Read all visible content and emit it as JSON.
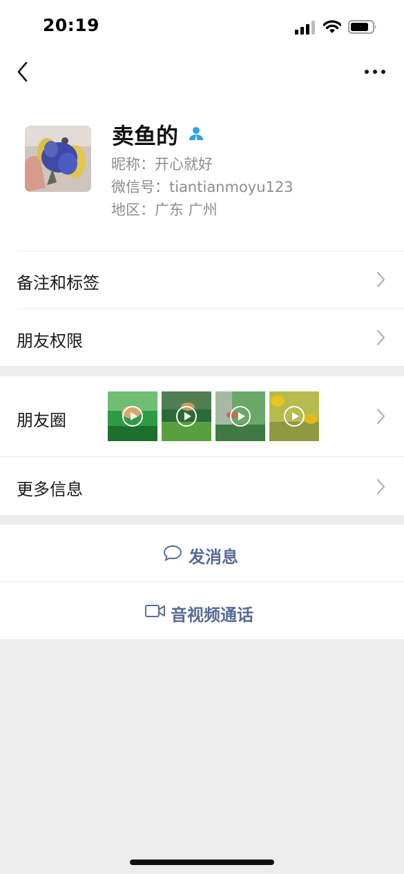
{
  "status_bar": {
    "time": "20:19",
    "icons": [
      "cellular-signal-icon",
      "wifi-icon",
      "battery-icon"
    ]
  },
  "nav": {
    "icons": [
      "back-chevron-icon",
      "more-dots-icon"
    ]
  },
  "profile": {
    "name": "卖鱼的",
    "nickname": "昵称：开心就好",
    "wechat_id": "微信号：tiantianmoyu123",
    "region": "地区：广东 广州",
    "badge_icon": "contact-person-icon",
    "badge_color": "#2aa4e8"
  },
  "menu": {
    "remarks_tags": "备注和标签",
    "friend_permissions": "朋友权限",
    "moments": "朋友圈",
    "more_info": "更多信息"
  },
  "moments_thumbnails": [
    {
      "type": "video",
      "icon": "play-icon"
    },
    {
      "type": "video",
      "icon": "play-icon"
    },
    {
      "type": "video",
      "icon": "play-icon"
    },
    {
      "type": "video",
      "icon": "play-icon"
    }
  ],
  "actions": {
    "send_message": "发消息",
    "av_call": "音视频通话",
    "accent_color": "#576b95"
  }
}
